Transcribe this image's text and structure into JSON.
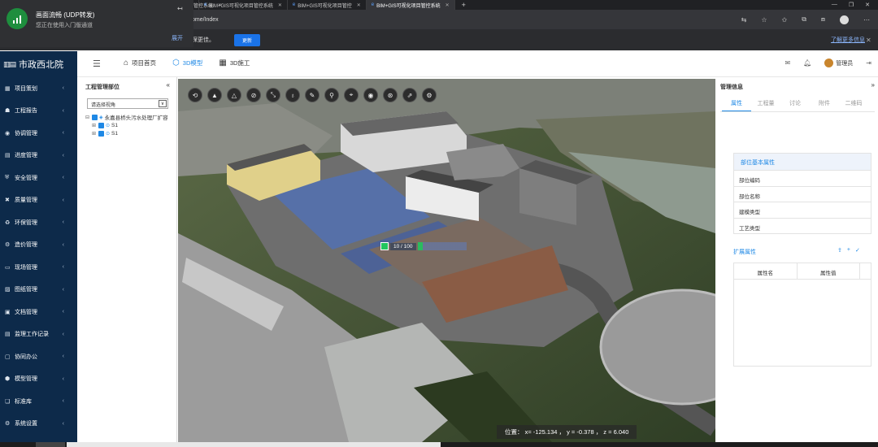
{
  "browser": {
    "tabs": [
      {
        "title": "管控系统",
        "active": false
      },
      {
        "title": "BIM+GIS可视化项目管控系统",
        "active": false
      },
      {
        "title": "BIM+GIS可视化项目管控",
        "active": false
      },
      {
        "title": "BIM+GIS可视化项目管控系统",
        "active": true
      }
    ],
    "url": "ome/Index",
    "infobar_text": "保更佳。",
    "infobar_button": "更新",
    "infobar_link": "了解更多信息"
  },
  "notification": {
    "title": "画面流畅 (UDP转发)",
    "subtitle": "您正在使用入门版通道",
    "action": "展开"
  },
  "header": {
    "logo_text": "市政西北院",
    "nav": [
      {
        "label": "项目首页",
        "icon": "home-icon",
        "active": false
      },
      {
        "label": "3D模型",
        "icon": "cube-icon",
        "active": true
      },
      {
        "label": "3D施工",
        "icon": "calendar-icon",
        "active": false
      }
    ],
    "user_name": "管理员"
  },
  "sidebar": {
    "items": [
      {
        "label": "项目策划",
        "icon": "grid-icon"
      },
      {
        "label": "工程报告",
        "icon": "users-icon"
      },
      {
        "label": "协调管理",
        "icon": "eye-icon"
      },
      {
        "label": "进度管理",
        "icon": "calendar-icon"
      },
      {
        "label": "安全管理",
        "icon": "shield-icon"
      },
      {
        "label": "质量管理",
        "icon": "cross-icon"
      },
      {
        "label": "环保管理",
        "icon": "recycle-icon"
      },
      {
        "label": "造价管理",
        "icon": "gear-icon"
      },
      {
        "label": "现场管理",
        "icon": "monitor-icon"
      },
      {
        "label": "图纸管理",
        "icon": "image-icon"
      },
      {
        "label": "文档管理",
        "icon": "folder-icon"
      },
      {
        "label": "监理工作记录",
        "icon": "doc-icon"
      },
      {
        "label": "协同办公",
        "icon": "chat-icon"
      },
      {
        "label": "模型管理",
        "icon": "cube-icon"
      },
      {
        "label": "标准库",
        "icon": "book-icon"
      },
      {
        "label": "系统设置",
        "icon": "settings-icon"
      }
    ]
  },
  "left_panel": {
    "title": "工程管理部位",
    "select_placeholder": "请选择视角",
    "tree": [
      {
        "label": "永嘉县桥头污水处理厂扩容",
        "level": 0
      },
      {
        "label": "S1",
        "level": 1
      },
      {
        "label": "S1",
        "level": 1
      }
    ]
  },
  "viewport": {
    "toolbar": [
      "rotate-icon",
      "mountain-icon",
      "terrain-icon",
      "eye-off-icon",
      "measure-icon",
      "bulb-icon",
      "pencil-icon",
      "pin-icon",
      "location-icon",
      "camera-icon",
      "target-icon",
      "export-icon",
      "settings-icon"
    ],
    "progress_label": "10 / 100",
    "progress_value": 0.1,
    "coords_text": "位置： x= -125.134 ， y = -0.378 ， z = 6.040"
  },
  "right_panel": {
    "title": "管理信息",
    "tabs": [
      "属性",
      "工程量",
      "讨论",
      "附件",
      "二维码"
    ],
    "basic_title": "部位基本属性",
    "basic_rows": [
      "部位编码",
      "部位名称",
      "建模类型",
      "工艺类型"
    ],
    "ext_title": "扩展属性",
    "ext_headers": [
      "属性名",
      "属性值"
    ]
  },
  "colors": {
    "sidebar_bg": "#0d2a4a",
    "accent": "#1e88e5",
    "browser_dark": "#202124"
  }
}
